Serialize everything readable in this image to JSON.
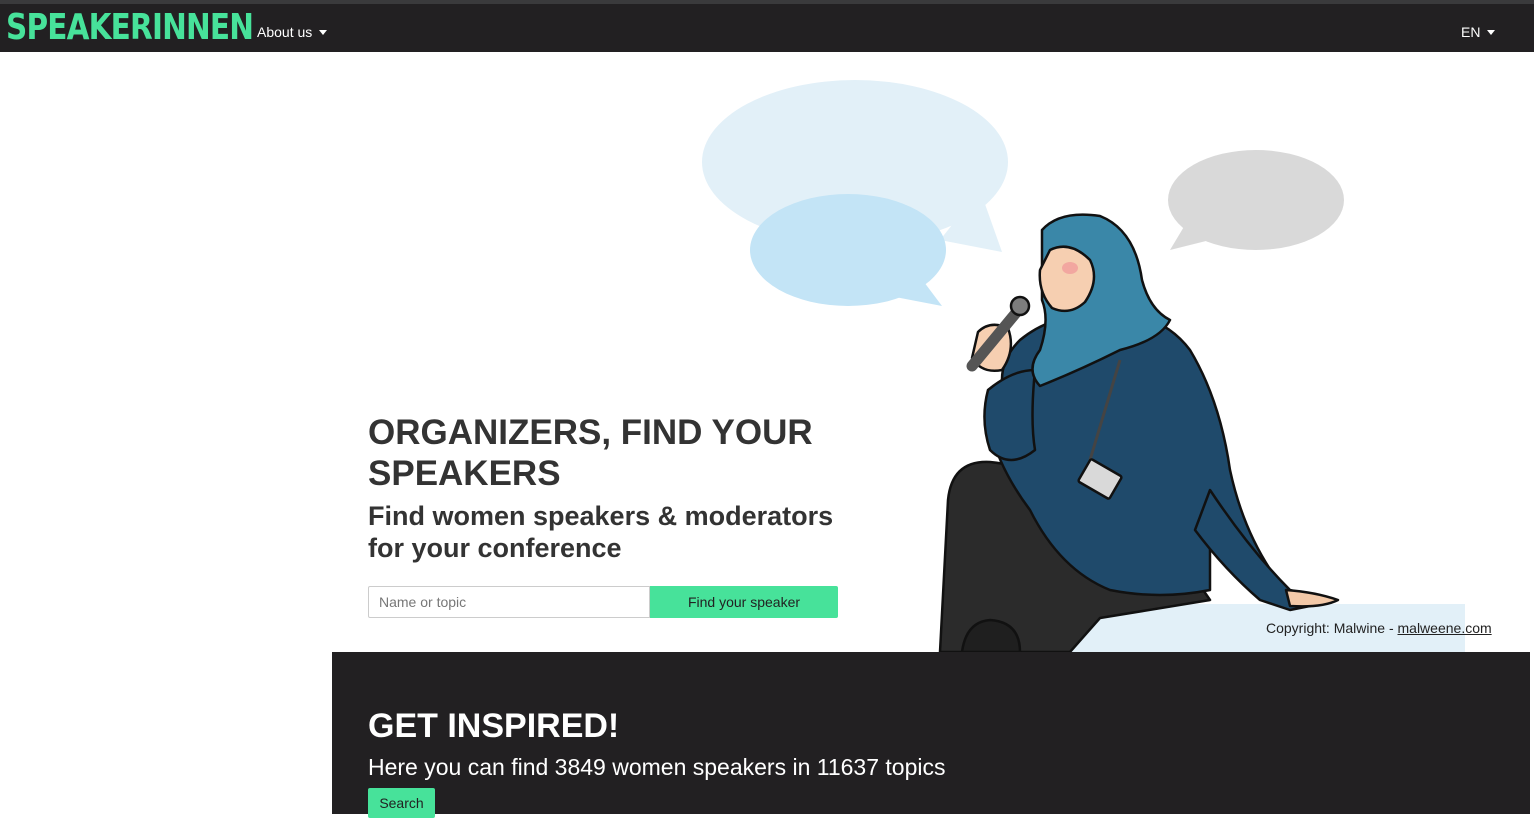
{
  "nav": {
    "logo_text": "SPEAKERINNEN",
    "about_label": "About us",
    "language_label": "EN"
  },
  "hero": {
    "title": "ORGANIZERS, FIND YOUR SPEAKERS",
    "subtitle": "Find women speakers & moderators for your conference",
    "search_placeholder": "Name or topic",
    "search_value": "",
    "find_button_label": "Find your speaker",
    "copyright_prefix": "Copyright: Malwine -",
    "copyright_link": "malweene.com"
  },
  "inspire": {
    "title": "GET INSPIRED!",
    "subtitle": "Here you can find 3849 women speakers in 11637 topics",
    "search_button_label": "Search"
  },
  "colors": {
    "accent": "#47e29a",
    "dark_bg": "#222022",
    "hijab": "#3a87a8",
    "jacket": "#1f4a6b",
    "bubble_light": "#e2f0f8",
    "bubble_blue": "#c3e4f6",
    "bubble_grey": "#d9d9d9"
  },
  "icons": {
    "about_dropdown": "chevron-down-icon",
    "language_dropdown": "chevron-down-icon"
  }
}
